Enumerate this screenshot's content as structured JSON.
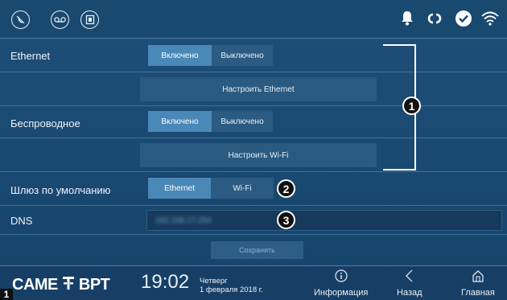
{
  "status_bar": {
    "left_icons": [
      "do-not-disturb-icon",
      "voicemail-icon",
      "door-open-icon"
    ],
    "right_icons": [
      "bell-icon",
      "link-icon",
      "check-circle-icon",
      "wifi-icon"
    ]
  },
  "ethernet": {
    "label": "Ethernet",
    "on_label": "Включено",
    "off_label": "Выключено",
    "selected": "on",
    "configure_label": "Настроить Ethernet"
  },
  "wireless": {
    "label": "Беспроводное",
    "on_label": "Включено",
    "off_label": "Выключено",
    "selected": "on",
    "configure_label": "Настроить Wi-Fi"
  },
  "gateway": {
    "label": "Шлюз по умолчанию",
    "options": [
      "Ethernet",
      "Wi-Fi"
    ],
    "selected": "Ethernet"
  },
  "dns": {
    "label": "DNS",
    "value": "192.168.17.254"
  },
  "save_label": "Сохранить",
  "callouts": [
    "1",
    "2",
    "3"
  ],
  "footer": {
    "logo_left": "CAME",
    "logo_right": "BPT",
    "time": "19:02",
    "weekday": "Четверг",
    "date": "1 февраля 2018 г.",
    "nav": [
      {
        "label": "Информация",
        "icon": "info-icon"
      },
      {
        "label": "Назад",
        "icon": "back-chevron-icon"
      },
      {
        "label": "Главная",
        "icon": "home-icon"
      }
    ]
  },
  "corner_tag": "1"
}
